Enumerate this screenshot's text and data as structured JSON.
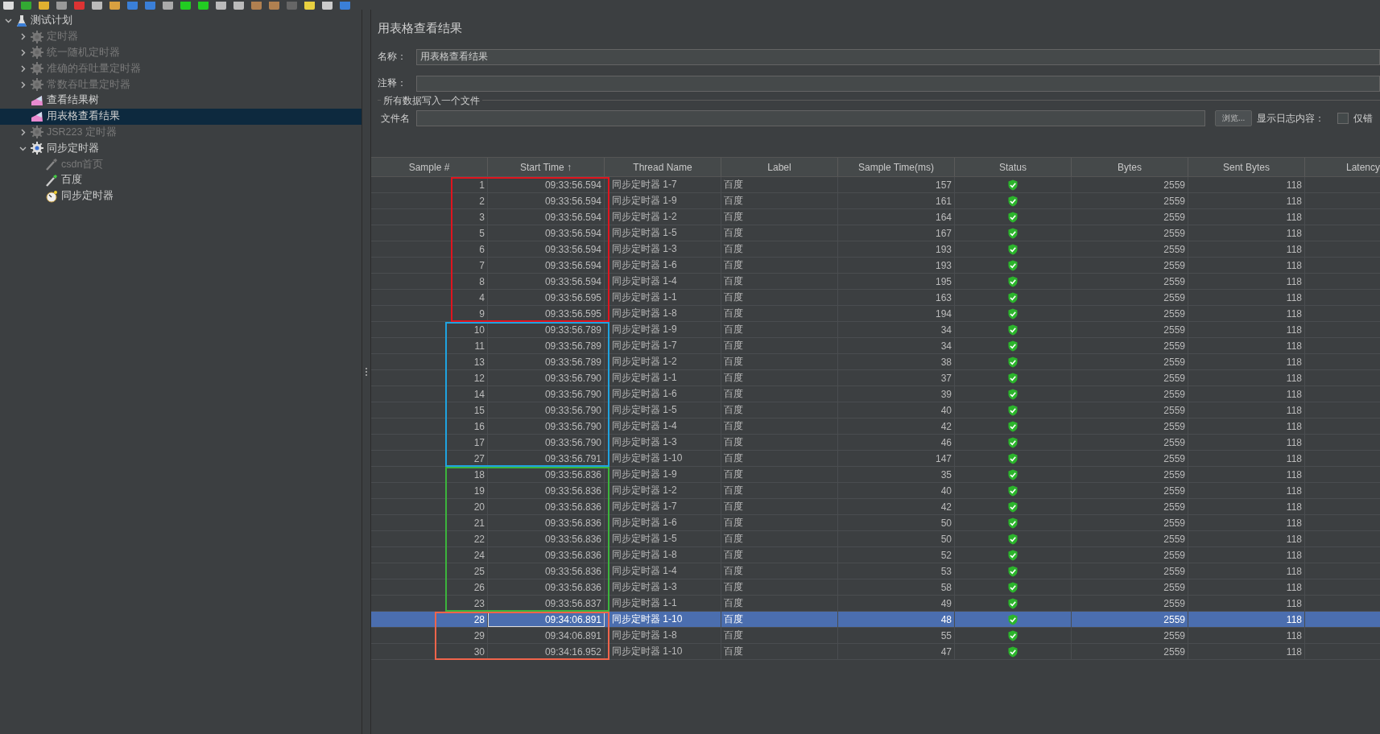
{
  "tree": [
    {
      "label": "测试计划",
      "kind": "flask",
      "expanded": true,
      "disabled": false,
      "selected": false,
      "children": [
        {
          "label": "定时器",
          "kind": "gear",
          "expanded": false,
          "disabled": true,
          "selected": false
        },
        {
          "label": "统一随机定时器",
          "kind": "gear",
          "expanded": false,
          "disabled": true,
          "selected": false
        },
        {
          "label": "准确的吞吐量定时器",
          "kind": "gear",
          "expanded": false,
          "disabled": true,
          "selected": false
        },
        {
          "label": "常数吞吐量定时器",
          "kind": "gear",
          "expanded": false,
          "disabled": true,
          "selected": false
        },
        {
          "label": "查看结果树",
          "kind": "listener",
          "disabled": false,
          "selected": false
        },
        {
          "label": "用表格查看结果",
          "kind": "listener",
          "disabled": false,
          "selected": true
        },
        {
          "label": "JSR223 定时器",
          "kind": "gear",
          "expanded": false,
          "disabled": true,
          "selected": false
        },
        {
          "label": "同步定时器",
          "kind": "gear",
          "expanded": true,
          "disabled": false,
          "selected": false,
          "children": [
            {
              "label": "csdn首页",
              "kind": "sampler",
              "disabled": true,
              "selected": false
            },
            {
              "label": "百度",
              "kind": "sampler",
              "disabled": false,
              "selected": false
            },
            {
              "label": "同步定时器",
              "kind": "timer",
              "disabled": false,
              "selected": false
            }
          ]
        }
      ]
    }
  ],
  "panel": {
    "title": "用表格查看结果",
    "name_label": "名称：",
    "name_value": "用表格查看结果",
    "comment_label": "注释：",
    "file_section": "所有数据写入一个文件",
    "file_label": "文件名",
    "browse_button": "浏览...",
    "log_label": "显示日志内容：",
    "errors_only": {
      "label": "仅错",
      "checked": false
    }
  },
  "table": {
    "columns": [
      "Sample #",
      "Start Time ↑",
      "Thread Name",
      "Label",
      "Sample Time(ms)",
      "Status",
      "Bytes",
      "Sent Bytes",
      "Latency"
    ],
    "row_groups": [
      {
        "color": "#e0141e",
        "rows": [
          {
            "sample": "1",
            "start": "09:33:56.594",
            "thread": "同步定时器 1-7",
            "label": "百度",
            "time": "157",
            "ok": true,
            "bytes": "2559",
            "sent": "118",
            "selected": false
          },
          {
            "sample": "2",
            "start": "09:33:56.594",
            "thread": "同步定时器 1-9",
            "label": "百度",
            "time": "161",
            "ok": true,
            "bytes": "2559",
            "sent": "118",
            "selected": false
          },
          {
            "sample": "3",
            "start": "09:33:56.594",
            "thread": "同步定时器 1-2",
            "label": "百度",
            "time": "164",
            "ok": true,
            "bytes": "2559",
            "sent": "118",
            "selected": false
          },
          {
            "sample": "5",
            "start": "09:33:56.594",
            "thread": "同步定时器 1-5",
            "label": "百度",
            "time": "167",
            "ok": true,
            "bytes": "2559",
            "sent": "118",
            "selected": false
          },
          {
            "sample": "6",
            "start": "09:33:56.594",
            "thread": "同步定时器 1-3",
            "label": "百度",
            "time": "193",
            "ok": true,
            "bytes": "2559",
            "sent": "118",
            "selected": false
          },
          {
            "sample": "7",
            "start": "09:33:56.594",
            "thread": "同步定时器 1-6",
            "label": "百度",
            "time": "193",
            "ok": true,
            "bytes": "2559",
            "sent": "118",
            "selected": false
          },
          {
            "sample": "8",
            "start": "09:33:56.594",
            "thread": "同步定时器 1-4",
            "label": "百度",
            "time": "195",
            "ok": true,
            "bytes": "2559",
            "sent": "118",
            "selected": false
          },
          {
            "sample": "4",
            "start": "09:33:56.595",
            "thread": "同步定时器 1-1",
            "label": "百度",
            "time": "163",
            "ok": true,
            "bytes": "2559",
            "sent": "118",
            "selected": false
          },
          {
            "sample": "9",
            "start": "09:33:56.595",
            "thread": "同步定时器 1-8",
            "label": "百度",
            "time": "194",
            "ok": true,
            "bytes": "2559",
            "sent": "118",
            "selected": false
          }
        ]
      },
      {
        "color": "#1fa3e0",
        "rows": [
          {
            "sample": "10",
            "start": "09:33:56.789",
            "thread": "同步定时器 1-9",
            "label": "百度",
            "time": "34",
            "ok": true,
            "bytes": "2559",
            "sent": "118",
            "selected": false
          },
          {
            "sample": "11",
            "start": "09:33:56.789",
            "thread": "同步定时器 1-7",
            "label": "百度",
            "time": "34",
            "ok": true,
            "bytes": "2559",
            "sent": "118",
            "selected": false
          },
          {
            "sample": "13",
            "start": "09:33:56.789",
            "thread": "同步定时器 1-2",
            "label": "百度",
            "time": "38",
            "ok": true,
            "bytes": "2559",
            "sent": "118",
            "selected": false
          },
          {
            "sample": "12",
            "start": "09:33:56.790",
            "thread": "同步定时器 1-1",
            "label": "百度",
            "time": "37",
            "ok": true,
            "bytes": "2559",
            "sent": "118",
            "selected": false
          },
          {
            "sample": "14",
            "start": "09:33:56.790",
            "thread": "同步定时器 1-6",
            "label": "百度",
            "time": "39",
            "ok": true,
            "bytes": "2559",
            "sent": "118",
            "selected": false
          },
          {
            "sample": "15",
            "start": "09:33:56.790",
            "thread": "同步定时器 1-5",
            "label": "百度",
            "time": "40",
            "ok": true,
            "bytes": "2559",
            "sent": "118",
            "selected": false
          },
          {
            "sample": "16",
            "start": "09:33:56.790",
            "thread": "同步定时器 1-4",
            "label": "百度",
            "time": "42",
            "ok": true,
            "bytes": "2559",
            "sent": "118",
            "selected": false
          },
          {
            "sample": "17",
            "start": "09:33:56.790",
            "thread": "同步定时器 1-3",
            "label": "百度",
            "time": "46",
            "ok": true,
            "bytes": "2559",
            "sent": "118",
            "selected": false
          },
          {
            "sample": "27",
            "start": "09:33:56.791",
            "thread": "同步定时器 1-10",
            "label": "百度",
            "time": "147",
            "ok": true,
            "bytes": "2559",
            "sent": "118",
            "selected": false
          }
        ]
      },
      {
        "color": "#3cb43c",
        "rows": [
          {
            "sample": "18",
            "start": "09:33:56.836",
            "thread": "同步定时器 1-9",
            "label": "百度",
            "time": "35",
            "ok": true,
            "bytes": "2559",
            "sent": "118",
            "selected": false
          },
          {
            "sample": "19",
            "start": "09:33:56.836",
            "thread": "同步定时器 1-2",
            "label": "百度",
            "time": "40",
            "ok": true,
            "bytes": "2559",
            "sent": "118",
            "selected": false
          },
          {
            "sample": "20",
            "start": "09:33:56.836",
            "thread": "同步定时器 1-7",
            "label": "百度",
            "time": "42",
            "ok": true,
            "bytes": "2559",
            "sent": "118",
            "selected": false
          },
          {
            "sample": "21",
            "start": "09:33:56.836",
            "thread": "同步定时器 1-6",
            "label": "百度",
            "time": "50",
            "ok": true,
            "bytes": "2559",
            "sent": "118",
            "selected": false
          },
          {
            "sample": "22",
            "start": "09:33:56.836",
            "thread": "同步定时器 1-5",
            "label": "百度",
            "time": "50",
            "ok": true,
            "bytes": "2559",
            "sent": "118",
            "selected": false
          },
          {
            "sample": "24",
            "start": "09:33:56.836",
            "thread": "同步定时器 1-8",
            "label": "百度",
            "time": "52",
            "ok": true,
            "bytes": "2559",
            "sent": "118",
            "selected": false
          },
          {
            "sample": "25",
            "start": "09:33:56.836",
            "thread": "同步定时器 1-4",
            "label": "百度",
            "time": "53",
            "ok": true,
            "bytes": "2559",
            "sent": "118",
            "selected": false
          },
          {
            "sample": "26",
            "start": "09:33:56.836",
            "thread": "同步定时器 1-3",
            "label": "百度",
            "time": "58",
            "ok": true,
            "bytes": "2559",
            "sent": "118",
            "selected": false
          },
          {
            "sample": "23",
            "start": "09:33:56.837",
            "thread": "同步定时器 1-1",
            "label": "百度",
            "time": "49",
            "ok": true,
            "bytes": "2559",
            "sent": "118",
            "selected": false
          }
        ]
      },
      {
        "color": "#f0644b",
        "rows": [
          {
            "sample": "28",
            "start": "09:34:06.891",
            "thread": "同步定时器 1-10",
            "label": "百度",
            "time": "48",
            "ok": true,
            "bytes": "2559",
            "sent": "118",
            "selected": true
          },
          {
            "sample": "29",
            "start": "09:34:06.891",
            "thread": "同步定时器 1-8",
            "label": "百度",
            "time": "55",
            "ok": true,
            "bytes": "2559",
            "sent": "118",
            "selected": false
          },
          {
            "sample": "30",
            "start": "09:34:16.952",
            "thread": "同步定时器 1-10",
            "label": "百度",
            "time": "47",
            "ok": true,
            "bytes": "2559",
            "sent": "118",
            "selected": false
          }
        ]
      }
    ]
  }
}
